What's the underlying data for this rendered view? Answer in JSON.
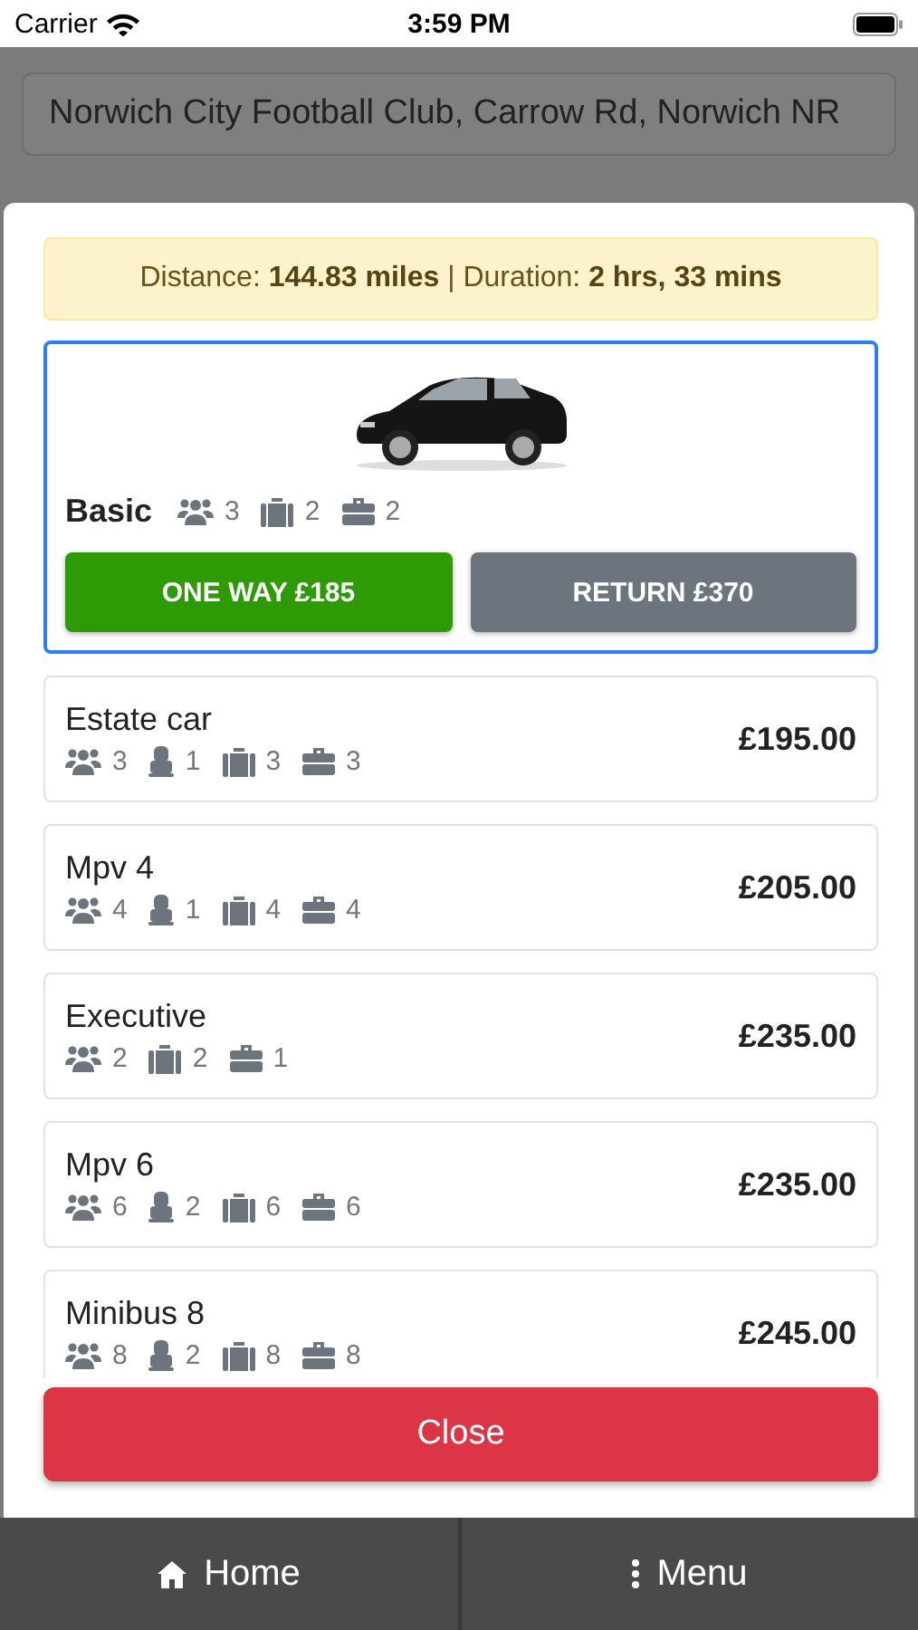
{
  "status_bar": {
    "carrier": "Carrier",
    "time": "3:59 PM"
  },
  "background": {
    "pickup_field": "Norwich City Football Club, Carrow Rd, Norwich NR"
  },
  "modal": {
    "summary": "Distance: **144.83 miles** | Duration: **2 hrs, 33 mins**",
    "selected_vehicle": {
      "name": "Basic",
      "selected": true,
      "features": [
        {
          "kind": "passengers",
          "count": "3"
        },
        {
          "kind": "suitcase",
          "count": "2"
        },
        {
          "kind": "briefcase",
          "count": "2"
        }
      ],
      "trip_buttons": [
        {
          "label": "ONE WAY £185",
          "selected": true
        },
        {
          "label": "RETURN £370",
          "selected": false
        }
      ]
    },
    "vehicles": [
      {
        "name": "Estate car",
        "price": "£195.00",
        "features": [
          {
            "kind": "passengers",
            "count": "3"
          },
          {
            "kind": "child_seat",
            "count": "1"
          },
          {
            "kind": "suitcase",
            "count": "3"
          },
          {
            "kind": "briefcase",
            "count": "3"
          }
        ]
      },
      {
        "name": "Mpv 4",
        "price": "£205.00",
        "features": [
          {
            "kind": "passengers",
            "count": "4"
          },
          {
            "kind": "child_seat",
            "count": "1"
          },
          {
            "kind": "suitcase",
            "count": "4"
          },
          {
            "kind": "briefcase",
            "count": "4"
          }
        ]
      },
      {
        "name": "Executive",
        "price": "£235.00",
        "features": [
          {
            "kind": "passengers",
            "count": "2"
          },
          {
            "kind": "suitcase",
            "count": "2"
          },
          {
            "kind": "briefcase",
            "count": "1"
          }
        ]
      },
      {
        "name": "Mpv 6",
        "price": "£235.00",
        "features": [
          {
            "kind": "passengers",
            "count": "6"
          },
          {
            "kind": "child_seat",
            "count": "2"
          },
          {
            "kind": "suitcase",
            "count": "6"
          },
          {
            "kind": "briefcase",
            "count": "6"
          }
        ]
      },
      {
        "name": "Minibus 8",
        "price": "£245.00",
        "features": [
          {
            "kind": "passengers",
            "count": "8"
          },
          {
            "kind": "child_seat",
            "count": "2"
          },
          {
            "kind": "suitcase",
            "count": "8"
          },
          {
            "kind": "briefcase",
            "count": "8"
          }
        ]
      }
    ],
    "close_button": "Close"
  },
  "bottom_nav": [
    {
      "kind": "home",
      "label": "Home"
    },
    {
      "kind": "menu",
      "label": "Menu"
    }
  ]
}
